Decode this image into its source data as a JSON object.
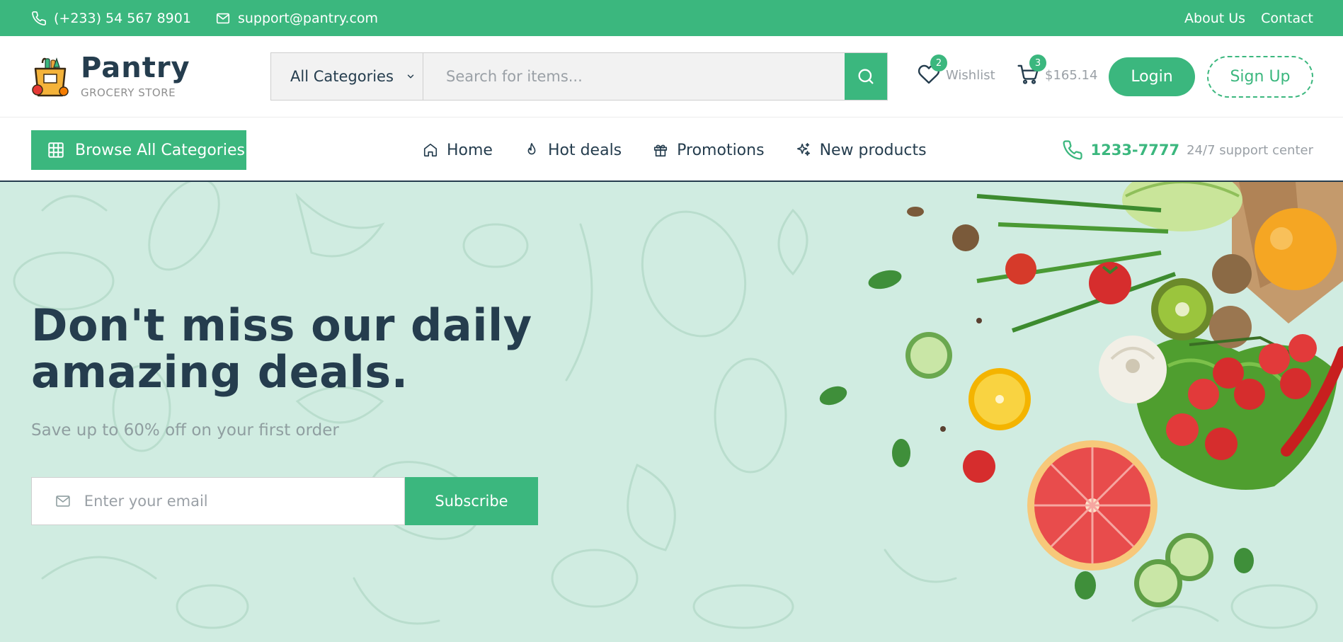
{
  "topbar": {
    "phone": "(+233) 54 567 8901",
    "email": "support@pantry.com",
    "links": [
      "About Us",
      "Contact"
    ]
  },
  "brand": {
    "name": "Pantry",
    "tagline": "GROCERY STORE"
  },
  "search": {
    "category": "All Categories",
    "placeholder": "Search for items..."
  },
  "wishlist": {
    "label": "Wishlist",
    "count": "2"
  },
  "cart": {
    "amount": "$165.14",
    "count": "3"
  },
  "auth": {
    "login": "Login",
    "signup": "Sign Up"
  },
  "nav": {
    "browse": "Browse All Categories",
    "items": [
      {
        "label": "Home",
        "icon": "home-icon"
      },
      {
        "label": "Hot deals",
        "icon": "flame-icon"
      },
      {
        "label": "Promotions",
        "icon": "gift-icon"
      },
      {
        "label": "New products",
        "icon": "sparkle-icon"
      }
    ],
    "support_number": "1233-7777",
    "support_text": "24/7 support center"
  },
  "hero": {
    "headline": "Don't miss our daily amazing deals.",
    "subtitle": "Save up to 60% off on your first order",
    "email_placeholder": "Enter your email",
    "subscribe": "Subscribe"
  },
  "colors": {
    "brand": "#3bb77e",
    "heading": "#253d4e",
    "hero_bg": "#d0ece1"
  }
}
